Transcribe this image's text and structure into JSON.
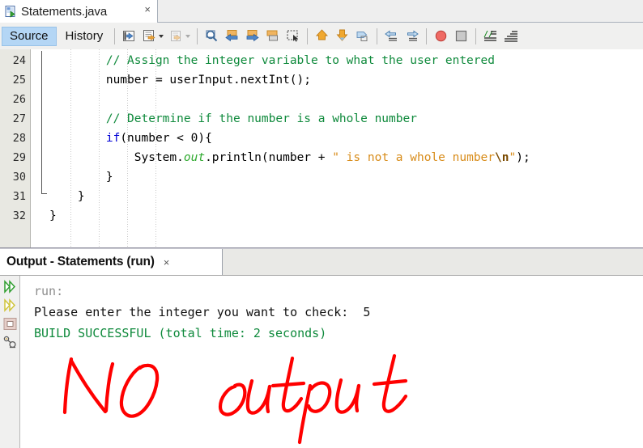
{
  "window": {
    "file_tab": {
      "label": "Statements.java",
      "close": "×",
      "icon": "java-file-icon"
    }
  },
  "view_tabs": [
    {
      "label": "Source",
      "selected": true
    },
    {
      "label": "History",
      "selected": false
    }
  ],
  "toolbar": {
    "groups": [
      {
        "buttons": [
          {
            "name": "last-edit-icon"
          },
          {
            "name": "toggle-bookmark-icon",
            "dropdown": true
          },
          {
            "name": "previous-bookmark-icon",
            "dropdown": true,
            "disabled": true
          }
        ]
      },
      {
        "buttons": [
          {
            "name": "find-selection-icon"
          },
          {
            "name": "find-previous-icon"
          },
          {
            "name": "find-next-icon"
          },
          {
            "name": "toggle-highlight-icon"
          },
          {
            "name": "toggle-rectangular-selection-icon"
          }
        ]
      },
      {
        "buttons": [
          {
            "name": "previous-bookmark-arrow-icon"
          },
          {
            "name": "next-bookmark-arrow-icon"
          },
          {
            "name": "toggle-bookmark-tag-icon"
          }
        ]
      },
      {
        "buttons": [
          {
            "name": "shift-left-icon"
          },
          {
            "name": "shift-right-icon"
          }
        ]
      },
      {
        "buttons": [
          {
            "name": "start-macro-recording-icon"
          },
          {
            "name": "stop-macro-recording-icon"
          }
        ]
      },
      {
        "buttons": [
          {
            "name": "comment-icon"
          },
          {
            "name": "uncomment-icon"
          }
        ]
      }
    ]
  },
  "editor": {
    "first_line": 24,
    "line_numbers": [
      24,
      25,
      26,
      27,
      28,
      29,
      30,
      31,
      32
    ],
    "lines": [
      {
        "n": 24,
        "tokens": [
          {
            "t": "        ",
            "c": "pl"
          },
          {
            "t": "// Assign the integer variable to what the user entered",
            "c": "com"
          }
        ]
      },
      {
        "n": 25,
        "tokens": [
          {
            "t": "        number = userInput.nextInt();",
            "c": "pl"
          }
        ]
      },
      {
        "n": 26,
        "tokens": [
          {
            "t": "",
            "c": "pl"
          }
        ]
      },
      {
        "n": 27,
        "tokens": [
          {
            "t": "        ",
            "c": "pl"
          },
          {
            "t": "// Determine if the number is a whole number",
            "c": "com"
          }
        ]
      },
      {
        "n": 28,
        "tokens": [
          {
            "t": "        ",
            "c": "pl"
          },
          {
            "t": "if",
            "c": "kw"
          },
          {
            "t": "(number < 0){",
            "c": "pl"
          }
        ]
      },
      {
        "n": 29,
        "tokens": [
          {
            "t": "            System.",
            "c": "pl"
          },
          {
            "t": "out",
            "c": "fld"
          },
          {
            "t": ".println(number + ",
            "c": "pl"
          },
          {
            "t": "\" is not a whole number",
            "c": "str"
          },
          {
            "t": "\\n",
            "c": "esc"
          },
          {
            "t": "\"",
            "c": "str"
          },
          {
            "t": ");",
            "c": "pl"
          }
        ]
      },
      {
        "n": 30,
        "tokens": [
          {
            "t": "        }",
            "c": "pl"
          }
        ]
      },
      {
        "n": 31,
        "tokens": [
          {
            "t": "    }",
            "c": "pl"
          }
        ]
      },
      {
        "n": 32,
        "tokens": [
          {
            "t": "}",
            "c": "pl"
          }
        ]
      }
    ]
  },
  "output": {
    "tab": {
      "label": "Output - Statements (run)",
      "close": "×"
    },
    "side_buttons": [
      {
        "name": "rerun-icon"
      },
      {
        "name": "rerun-alternate-icon"
      },
      {
        "name": "stop-icon"
      },
      {
        "name": "attach-debugger-icon"
      }
    ],
    "lines": [
      {
        "text": "run:",
        "color": "gray"
      },
      {
        "text": "Please enter the integer you want to check:  5",
        "color": "black"
      },
      {
        "text": "BUILD SUCCESSFUL (total time: 2 seconds)",
        "color": "green"
      }
    ]
  },
  "annotation": {
    "text": "NO output",
    "color": "#ff0000",
    "style": "handwritten-red-ink"
  },
  "colors": {
    "comment": "#0f8a3c",
    "keyword": "#0000d6",
    "string": "#d88c1a",
    "field": "#2faa2f",
    "build_success": "#0f8a3c",
    "tab_selected_bg": "#b4d6f5",
    "annotation_red": "#ff0000"
  }
}
